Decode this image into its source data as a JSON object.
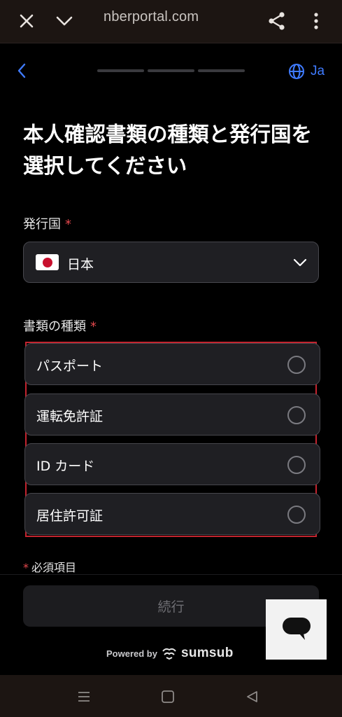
{
  "browser": {
    "url": "nberportal.com"
  },
  "header": {
    "language": "Ja",
    "progress_steps": 3
  },
  "title": "本人確認書類の種類と発行国を選択してください",
  "country_field": {
    "label": "発行国",
    "required_mark": "*",
    "value": "日本",
    "flag": "japan-flag"
  },
  "document_field": {
    "label": "書類の種類",
    "required_mark": "*",
    "options": [
      {
        "label": "パスポート"
      },
      {
        "label": "運転免許証"
      },
      {
        "label": "ID カード"
      },
      {
        "label": "居住許可証"
      }
    ]
  },
  "required_note": {
    "mark": "*",
    "text": "必須項目"
  },
  "continue_button": "続行",
  "footer": {
    "powered_by": "Powered by",
    "brand": "sumsub"
  },
  "colors": {
    "accent": "#3f7bff",
    "required": "#e5484d",
    "highlight_border": "#c3242f",
    "background": "#000000",
    "field_bg": "#1f1f23"
  }
}
